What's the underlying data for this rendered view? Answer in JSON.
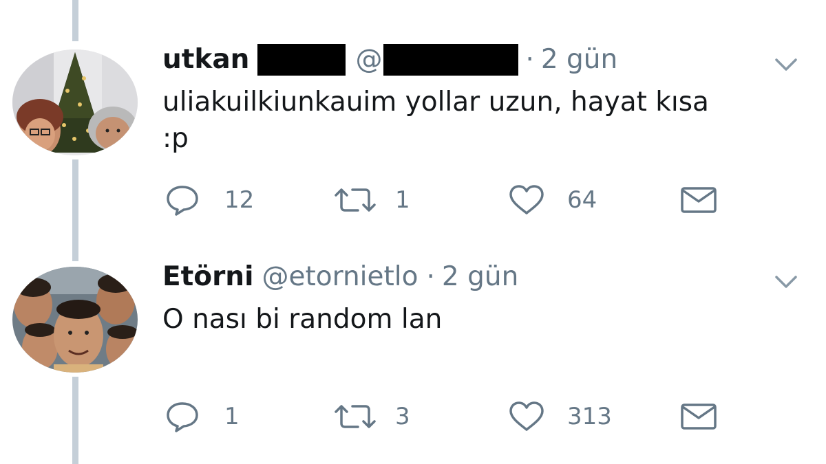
{
  "tweets": [
    {
      "name": "utkan",
      "handle_prefix": "@",
      "dot": "·",
      "time": "2 gün",
      "text": "uliakuilkiunkauim yollar uzun, hayat kısa :p",
      "counts": {
        "reply": "12",
        "retweet": "1",
        "like": "64"
      }
    },
    {
      "name": "Etörni",
      "handle": "@etornietlo",
      "dot": "·",
      "time": "2 gün",
      "text": "O nası bi random lan",
      "counts": {
        "reply": "1",
        "retweet": "3",
        "like": "313"
      }
    }
  ],
  "colors": {
    "text_primary": "#14171a",
    "text_secondary": "#657786",
    "thread_line": "#c5cfd8",
    "redaction": "#000000"
  },
  "icons": {
    "reply": "reply-icon",
    "retweet": "retweet-icon",
    "like": "heart-icon",
    "dm": "envelope-icon",
    "menu": "chevron-down-icon"
  }
}
